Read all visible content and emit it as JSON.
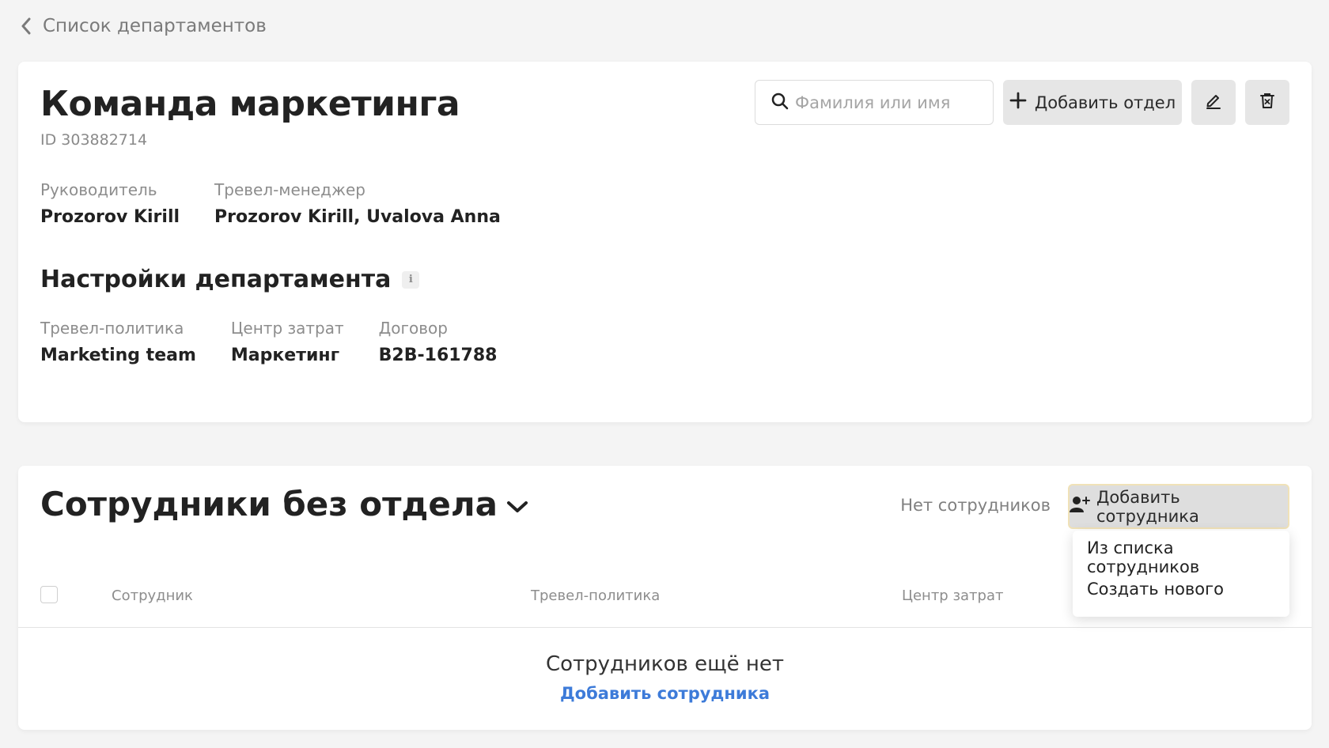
{
  "nav": {
    "back_label": "Список департаментов"
  },
  "department": {
    "title": "Команда маркетинга",
    "id_text": "ID 303882714",
    "head_label": "Руководитель",
    "head_value": "Prozorov Kirill",
    "travel_manager_label": "Тревел-менеджер",
    "travel_manager_value": "Prozorov Kirill, Uvalova Anna"
  },
  "toolbar": {
    "search_placeholder": "Фамилия или имя",
    "add_dept_label": "Добавить отдел",
    "edit_icon": "pencil-icon",
    "delete_icon": "trash-icon"
  },
  "settings": {
    "title": "Настройки департамента",
    "info_glyph": "i",
    "policy_label": "Тревел-политика",
    "policy_value": "Marketing team",
    "cost_center_label": "Центр затрат",
    "cost_center_value": "Маркетинг",
    "contract_label": "Договор",
    "contract_value": "B2B-161788"
  },
  "employees": {
    "title": "Сотрудники без отдела",
    "count_text": "Нет сотрудников",
    "add_label": "Добавить сотрудника",
    "menu": [
      "Из списка сотрудников",
      "Создать нового"
    ],
    "columns": [
      "Сотрудник",
      "Тревел-политика",
      "Центр затрат"
    ],
    "empty_text": "Сотрудников ещё нет",
    "empty_link": "Добавить сотрудника"
  },
  "colors": {
    "link": "#3d7bd9",
    "background": "#f4f4f4",
    "button": "#e6e6e6"
  }
}
